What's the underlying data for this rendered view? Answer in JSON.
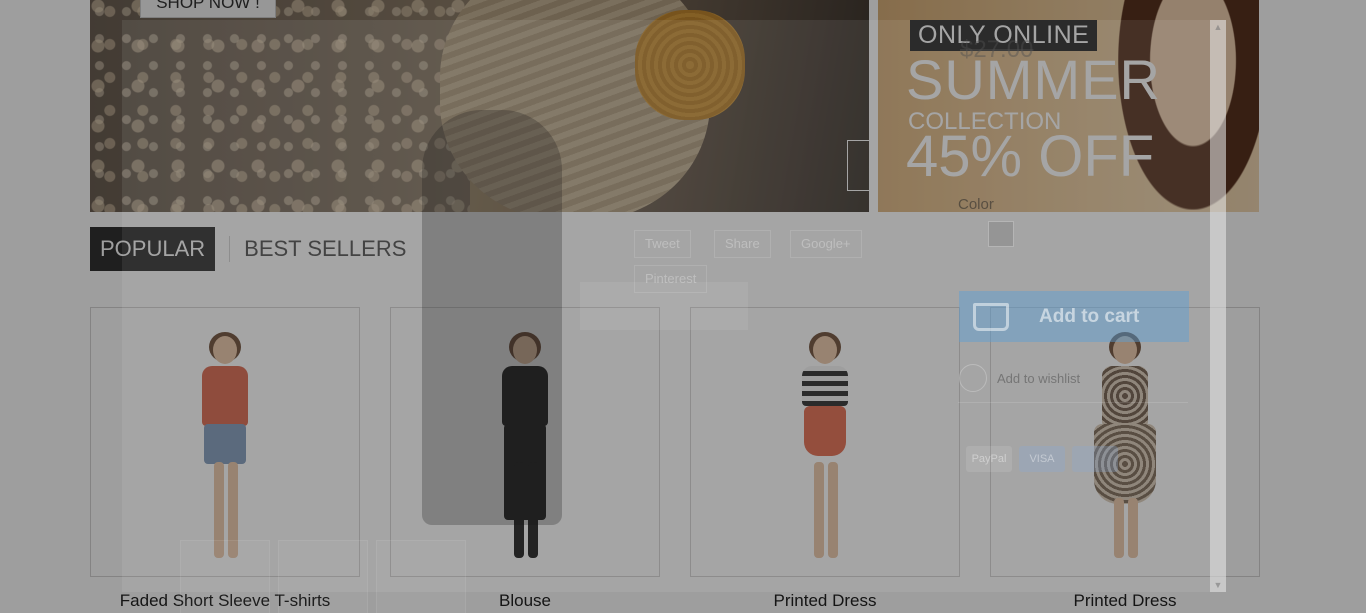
{
  "slider": {
    "shop_now_label": "SHOP NOW !",
    "prev_icon": "chevron-left-icon",
    "next_icon": "chevron-right-icon"
  },
  "promo": {
    "badge": "ONLY ONLINE",
    "headline": "SUMMER",
    "subline": "COLLECTION",
    "discount": "45% OFF"
  },
  "tabs": [
    {
      "label": "POPULAR",
      "active": true
    },
    {
      "label": "BEST SELLERS",
      "active": false
    }
  ],
  "products": [
    {
      "name": "Faded Short Sleeve T-shirts",
      "top_color": "#d9634a",
      "bottom_color": "#7e98b8"
    },
    {
      "name": "Blouse",
      "top_color": "#1c1c1c",
      "bottom_color": "#1c1c1c"
    },
    {
      "name": "Printed Dress",
      "top_color": "#2b2b2b",
      "bottom_color": "#e0664a"
    },
    {
      "name": "Printed Dress",
      "top_color": "#6e5a48",
      "bottom_color": "#7a6654"
    }
  ],
  "quick_view": {
    "price": "$27.00",
    "share_buttons": [
      "Tweet",
      "Share",
      "Google+",
      "Pinterest"
    ],
    "color_label": "Color",
    "add_to_cart_label": "Add to cart",
    "wishlist_label": "Add to wishlist",
    "payment_methods": [
      "PayPal",
      "VISA"
    ]
  },
  "colors": {
    "tab_active_bg": "#333333",
    "overlay": "rgba(0,0,0,0.38)",
    "cart_button": "#5aa0d7"
  }
}
